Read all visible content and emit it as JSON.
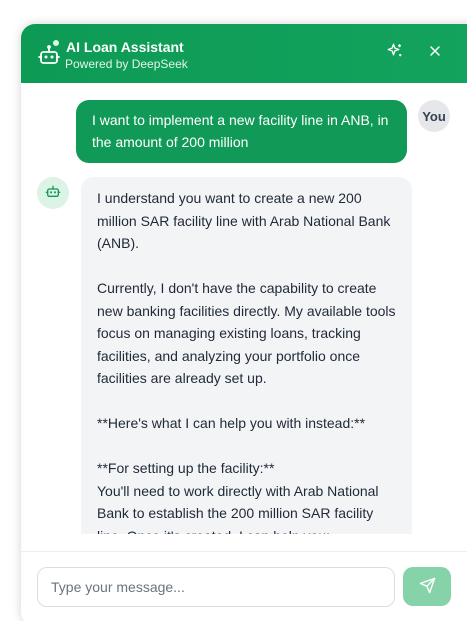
{
  "header": {
    "title": "AI Loan Assistant",
    "subtitle": "Powered by DeepSeek",
    "icons": [
      "robot-icon",
      "sparkle-icon",
      "close-icon"
    ]
  },
  "messages": {
    "user": {
      "avatar_label": "You",
      "text": "I want to implement a new facility line in ANB, in the amount of 200 million"
    },
    "assistant": {
      "paragraphs": [
        "I understand you want to create a new 200 million SAR facility line with Arab National Bank (ANB).",
        "Currently, I don't have the capability to create new banking facilities directly. My available tools focus on managing existing loans, tracking facilities, and analyzing your portfolio once facilities are already set up.",
        "**Here's what I can help you with instead:**",
        "**For setting up the facility:**",
        "You'll need to work directly with Arab National Bank to establish the 200 million SAR facility line. Once it's created, I can help you:"
      ]
    }
  },
  "composer": {
    "placeholder": "Type your message..."
  },
  "colors": {
    "brand": "#0d9a55",
    "user_bubble": "#119a57",
    "send_button": "#86d2a9",
    "assistant_bubble": "#f3f4f6"
  }
}
